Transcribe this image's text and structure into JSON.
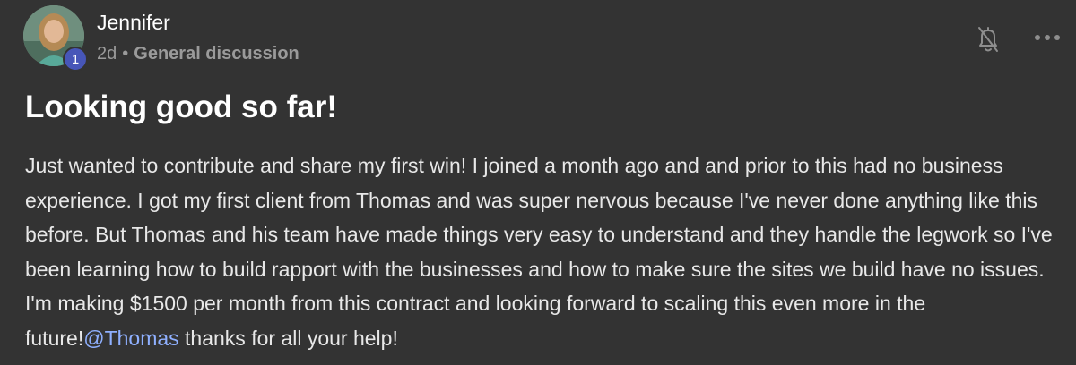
{
  "author": {
    "name": "Jennifer",
    "level": "1"
  },
  "meta": {
    "time": "2d",
    "separator": "•",
    "category": "General discussion"
  },
  "icons": {
    "bell": "bell-off-icon",
    "more": "more-horizontal-icon"
  },
  "post": {
    "title": "Looking good so far!",
    "body_before_mention": "Just wanted to contribute and share my first win! I joined a month ago and and prior to this had no business experience. I got my first client from Thomas and was super nervous because I've never done anything like this before. But Thomas and his team have made things very easy to understand and they handle the legwork so I've been learning how to build rapport with the businesses and how to make sure the sites we build have no issues. I'm making $1500 per month from this contract and looking forward to scaling this even more in the future!",
    "mention": "@Thomas",
    "body_after_mention": " thanks for all your help!"
  },
  "colors": {
    "background": "#333333",
    "mention": "#8fb0ff",
    "badge": "#4756b8"
  }
}
